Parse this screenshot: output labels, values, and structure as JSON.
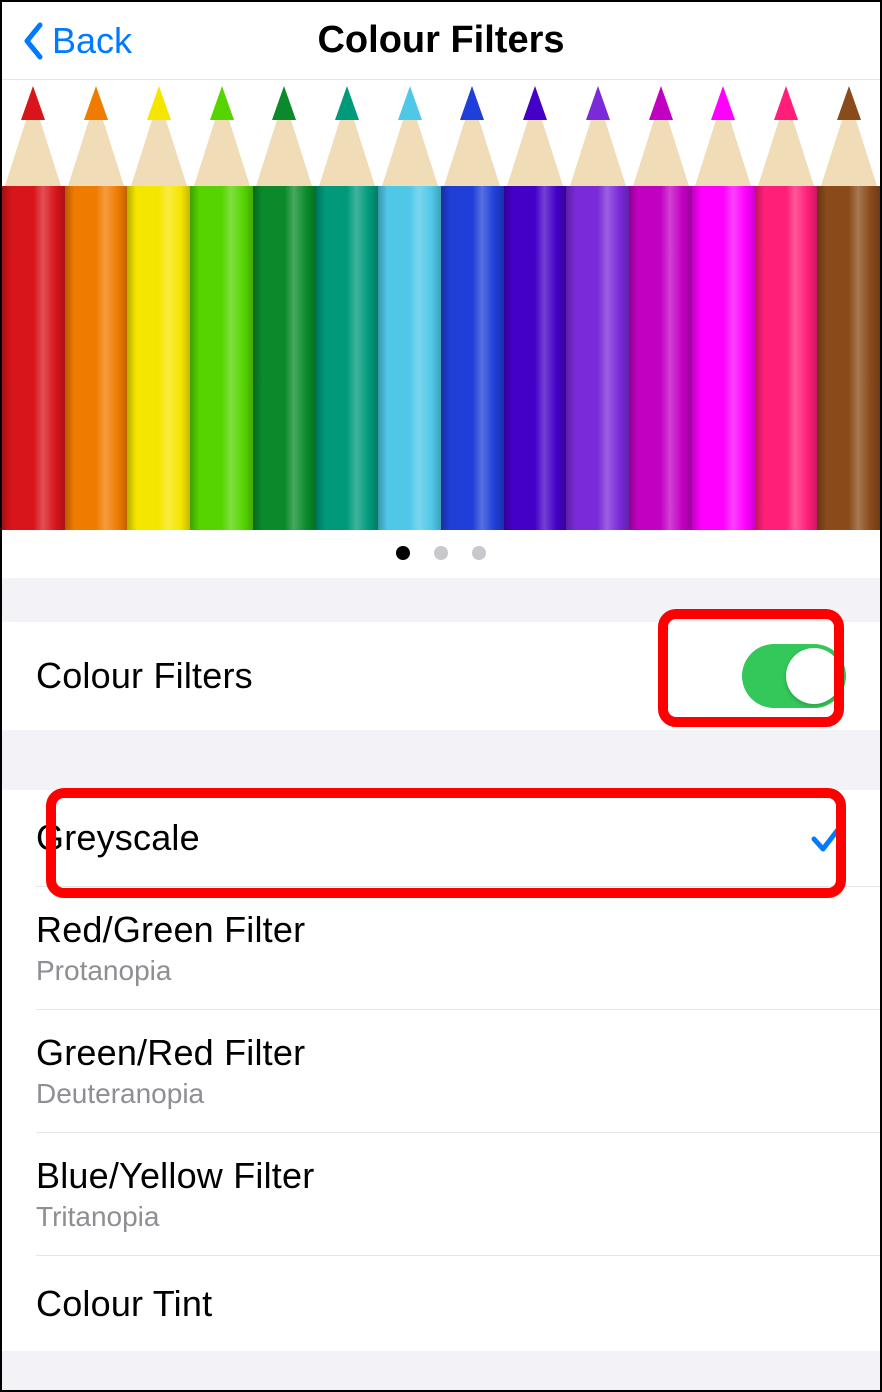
{
  "nav": {
    "back_label": "Back",
    "title": "Colour Filters"
  },
  "preview": {
    "page_count": 3,
    "active_page_index": 0,
    "pencil_colors": [
      "#d8151b",
      "#ef7b00",
      "#f5e600",
      "#55d400",
      "#0a8a2a",
      "#009a7b",
      "#4fc8e8",
      "#1f3fd8",
      "#4400c7",
      "#7a2ad8",
      "#c200c2",
      "#ff00ff",
      "#ff1e78",
      "#8a4a1a"
    ]
  },
  "toggle_row": {
    "label": "Colour Filters",
    "enabled": true
  },
  "filters": [
    {
      "label": "Greyscale",
      "sub": "",
      "selected": true
    },
    {
      "label": "Red/Green Filter",
      "sub": "Protanopia",
      "selected": false
    },
    {
      "label": "Green/Red Filter",
      "sub": "Deuteranopia",
      "selected": false
    },
    {
      "label": "Blue/Yellow Filter",
      "sub": "Tritanopia",
      "selected": false
    },
    {
      "label": "Colour Tint",
      "sub": "",
      "selected": false
    }
  ],
  "highlights": {
    "toggle": true,
    "selected_filter": true
  }
}
